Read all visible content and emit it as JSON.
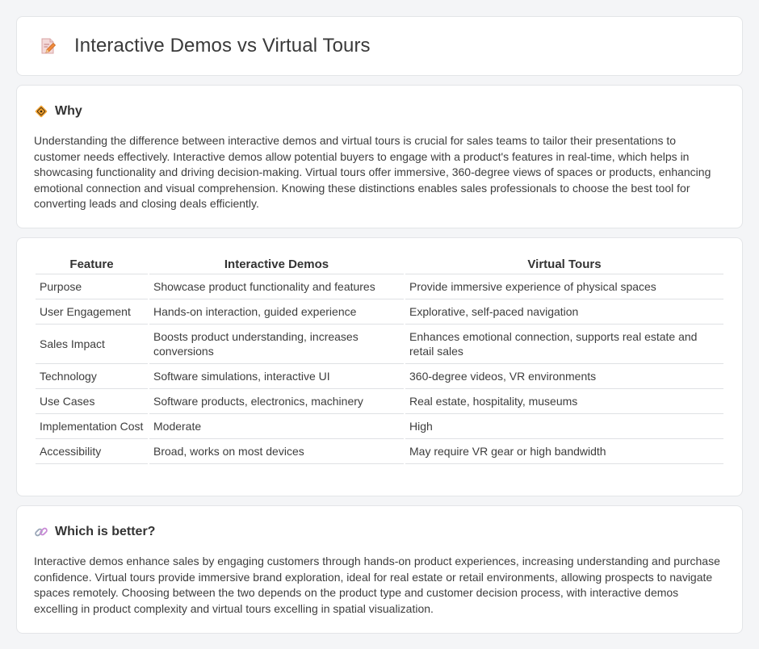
{
  "header": {
    "title": "Interactive Demos vs Virtual Tours",
    "icon": "document-pencil-icon"
  },
  "why": {
    "heading": "Why",
    "icon": "diamond-sign-icon",
    "text": "Understanding the difference between interactive demos and virtual tours is crucial for sales teams to tailor their presentations to customer needs effectively. Interactive demos allow potential buyers to engage with a product's features in real-time, which helps in showcasing functionality and driving decision-making. Virtual tours offer immersive, 360-degree views of spaces or products, enhancing emotional connection and visual comprehension. Knowing these distinctions enables sales professionals to choose the best tool for converting leads and closing deals efficiently."
  },
  "comparison": {
    "headers": [
      "Feature",
      "Interactive Demos",
      "Virtual Tours"
    ],
    "rows": [
      [
        "Purpose",
        "Showcase product functionality and features",
        "Provide immersive experience of physical spaces"
      ],
      [
        "User Engagement",
        "Hands-on interaction, guided experience",
        "Explorative, self-paced navigation"
      ],
      [
        "Sales Impact",
        "Boosts product understanding, increases conversions",
        "Enhances emotional connection, supports real estate and retail sales"
      ],
      [
        "Technology",
        "Software simulations, interactive UI",
        "360-degree videos, VR environments"
      ],
      [
        "Use Cases",
        "Software products, electronics, machinery",
        "Real estate, hospitality, museums"
      ],
      [
        "Implementation Cost",
        "Moderate",
        "High"
      ],
      [
        "Accessibility",
        "Broad, works on most devices",
        "May require VR gear or high bandwidth"
      ]
    ]
  },
  "better": {
    "heading": "Which is better?",
    "icon": "link-icon",
    "text": "Interactive demos enhance sales by engaging customers through hands-on product experiences, increasing understanding and purchase confidence. Virtual tours provide immersive brand exploration, ideal for real estate or retail environments, allowing prospects to navigate spaces remotely. Choosing between the two depends on the product type and customer decision process, with interactive demos excelling in product complexity and virtual tours excelling in spatial visualization."
  },
  "colors": {
    "background": "#f4f5f7",
    "card": "#ffffff",
    "border": "#e3e5e8",
    "icon_orange": "#f0a030",
    "icon_pink": "#e88a9a"
  }
}
